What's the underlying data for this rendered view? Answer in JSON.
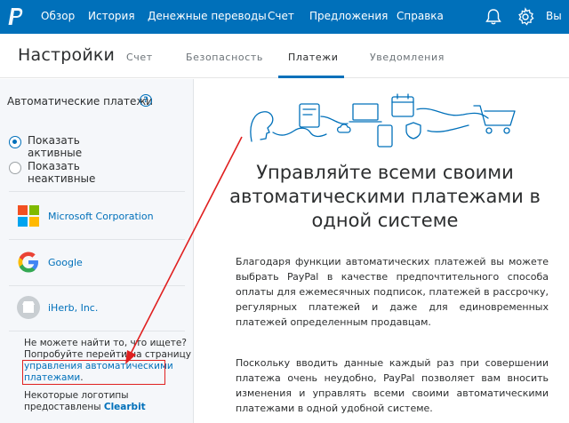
{
  "topnav": {
    "items": [
      "Обзор",
      "История",
      "Денежные переводы",
      "Счет",
      "Предложения",
      "Справка"
    ],
    "icons": [
      "bell-icon",
      "gear-icon"
    ],
    "logout": "Вы",
    "brand_color": "#0070ba"
  },
  "subnav": {
    "title": "Настройки",
    "tabs": [
      "Счет",
      "Безопасность",
      "Платежи",
      "Уведомления"
    ],
    "active_tab": "Платежи"
  },
  "sidebar": {
    "heading": "Автоматические платежи",
    "help_symbol": "?",
    "filters": [
      {
        "label": "Показать активные",
        "selected": true
      },
      {
        "label": "Показать неактивные",
        "selected": false
      }
    ],
    "merchants": [
      "Microsoft Corporation",
      "Google",
      "iHerb, Inc."
    ],
    "help": {
      "line1": "Не можете найти то, что ищете?",
      "line2": "Попробуйте перейти на страницу",
      "link_line1": "управления автоматическими",
      "link_line2": "платежами",
      "link_suffix": ".",
      "logos_line1": "Некоторые логотипы",
      "logos_line2": "предоставлены",
      "logos_brand": "Clearbit"
    }
  },
  "main": {
    "headline": [
      "Управляйте всеми своими",
      "автоматическими платежами в",
      "одной системе"
    ],
    "paragraph1": "Благодаря функции автоматических платежей вы можете выбрать PayPal в качестве предпочтительного способа оплаты для ежемесячных подписок, платежей в рассрочку, регулярных платежей и даже для единовременных платежей определенным продавцам.",
    "paragraph2": "Поскольку вводить данные каждый раз при совершении платежа очень неудобно, PayPal позволяет вам вносить изменения и управлять всеми своими автоматическими платежами в одной удобной системе."
  },
  "colors": {
    "annotation": "#e02020",
    "link": "#0070ba",
    "sidebar_bg": "#f5f7fa"
  }
}
